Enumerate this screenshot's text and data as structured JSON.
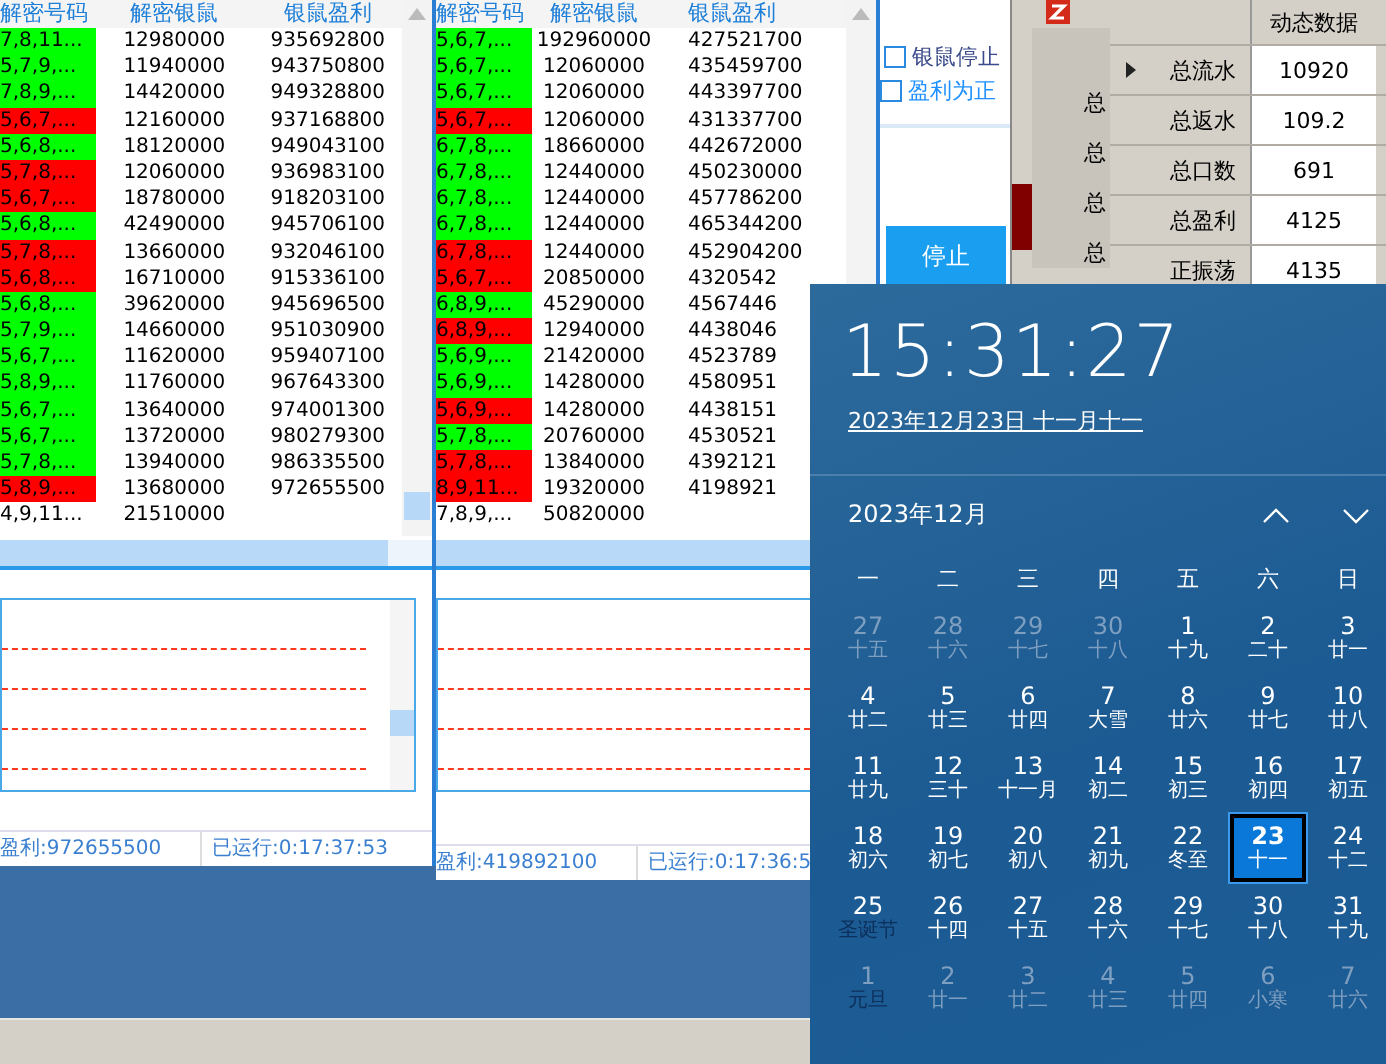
{
  "windows": [
    {
      "table": {
        "columns": [
          "解密号码",
          "解密银鼠",
          "银鼠盈利"
        ],
        "rows": [
          {
            "cells": [
              "7,8,11...",
              "12980000",
              "935692800"
            ],
            "color": "#00ff00"
          },
          {
            "cells": [
              "5,7,9,...",
              "11940000",
              "943750800"
            ],
            "color": "#00ff00"
          },
          {
            "cells": [
              "7,8,9,...",
              "14420000",
              "949328800"
            ],
            "color": "#00ff00"
          },
          {
            "cells": [
              "5,6,7,...",
              "12160000",
              "937168800"
            ],
            "color": "#ff0000"
          },
          {
            "cells": [
              "5,6,8,...",
              "18120000",
              "949043100"
            ],
            "color": "#00ff00"
          },
          {
            "cells": [
              "5,7,8,...",
              "12060000",
              "936983100"
            ],
            "color": "#ff0000"
          },
          {
            "cells": [
              "5,6,7,...",
              "18780000",
              "918203100"
            ],
            "color": "#ff0000"
          },
          {
            "cells": [
              "5,6,8,...",
              "42490000",
              "945706100"
            ],
            "color": "#00ff00"
          },
          {
            "cells": [
              "5,7,8,...",
              "13660000",
              "932046100"
            ],
            "color": "#ff0000"
          },
          {
            "cells": [
              "5,6,8,...",
              "16710000",
              "915336100"
            ],
            "color": "#ff0000"
          },
          {
            "cells": [
              "5,6,8,...",
              "39620000",
              "945696500"
            ],
            "color": "#00ff00"
          },
          {
            "cells": [
              "5,7,9,...",
              "14660000",
              "951030900"
            ],
            "color": "#00ff00"
          },
          {
            "cells": [
              "5,6,7,...",
              "11620000",
              "959407100"
            ],
            "color": "#00ff00"
          },
          {
            "cells": [
              "5,8,9,...",
              "11760000",
              "967643300"
            ],
            "color": "#00ff00"
          },
          {
            "cells": [
              "5,6,7,...",
              "13640000",
              "974001300"
            ],
            "color": "#00ff00"
          },
          {
            "cells": [
              "5,6,7,...",
              "13720000",
              "980279300"
            ],
            "color": "#00ff00"
          },
          {
            "cells": [
              "5,7,8,...",
              "13940000",
              "986335500"
            ],
            "color": "#00ff00"
          },
          {
            "cells": [
              "5,8,9,...",
              "13680000",
              "972655500"
            ],
            "color": "#ff0000"
          },
          {
            "cells": [
              "4,9,11...",
              "21510000",
              ""
            ],
            "color": "#ffffff"
          }
        ]
      },
      "status": [
        "盈利:972655500",
        "已运行:0:17:37:53"
      ]
    },
    {
      "table": {
        "columns": [
          "解密号码",
          "解密银鼠",
          "银鼠盈利"
        ],
        "rows": [
          {
            "cells": [
              "5,6,7,...",
              "192960000",
              "427521700"
            ],
            "color": "#00ff00"
          },
          {
            "cells": [
              "5,6,7,...",
              "12060000",
              "435459700"
            ],
            "color": "#00ff00"
          },
          {
            "cells": [
              "5,6,7,...",
              "12060000",
              "443397700"
            ],
            "color": "#00ff00"
          },
          {
            "cells": [
              "5,6,7,...",
              "12060000",
              "431337700"
            ],
            "color": "#ff0000"
          },
          {
            "cells": [
              "6,7,8,...",
              "18660000",
              "442672000"
            ],
            "color": "#00ff00"
          },
          {
            "cells": [
              "6,7,8,...",
              "12440000",
              "450230000"
            ],
            "color": "#00ff00"
          },
          {
            "cells": [
              "6,7,8,...",
              "12440000",
              "457786200"
            ],
            "color": "#00ff00"
          },
          {
            "cells": [
              "6,7,8,...",
              "12440000",
              "465344200"
            ],
            "color": "#00ff00"
          },
          {
            "cells": [
              "6,7,8,...",
              "12440000",
              "452904200"
            ],
            "color": "#ff0000"
          },
          {
            "cells": [
              "5,6,7,...",
              "20850000",
              "4320542"
            ],
            "color": "#ff0000"
          },
          {
            "cells": [
              "6,8,9,...",
              "45290000",
              "4567446"
            ],
            "color": "#00ff00"
          },
          {
            "cells": [
              "6,8,9,...",
              "12940000",
              "4438046"
            ],
            "color": "#ff0000"
          },
          {
            "cells": [
              "5,6,9,...",
              "21420000",
              "4523789"
            ],
            "color": "#00ff00"
          },
          {
            "cells": [
              "5,6,9,...",
              "14280000",
              "4580951"
            ],
            "color": "#00ff00"
          },
          {
            "cells": [
              "5,6,9,...",
              "14280000",
              "4438151"
            ],
            "color": "#ff0000"
          },
          {
            "cells": [
              "5,7,8,...",
              "20760000",
              "4530521"
            ],
            "color": "#00ff00"
          },
          {
            "cells": [
              "5,7,8,...",
              "13840000",
              "4392121"
            ],
            "color": "#ff0000"
          },
          {
            "cells": [
              "8,9,11...",
              "19320000",
              "4198921"
            ],
            "color": "#ff0000"
          },
          {
            "cells": [
              "7,8,9,...",
              "50820000",
              ""
            ],
            "color": "#ffffff"
          }
        ]
      },
      "status": [
        "盈利:419892100",
        "已运行:0:17:36:5"
      ]
    }
  ],
  "controls": {
    "checkboxes": [
      {
        "label": "银鼠停止",
        "checked": false
      },
      {
        "label": "盈利为正",
        "checked": false
      }
    ],
    "button": "停止"
  },
  "side_window": {
    "labels": [
      "总",
      "总",
      "总",
      "总"
    ]
  },
  "stats": {
    "column": "动态数据",
    "rows": [
      {
        "label": "总流水",
        "value": "10920",
        "selected": true
      },
      {
        "label": "总返水",
        "value": "109.2",
        "selected": false
      },
      {
        "label": "总口数",
        "value": "691",
        "selected": false
      },
      {
        "label": "总盈利",
        "value": "4125",
        "selected": false
      },
      {
        "label": "正振荡",
        "value": "4135",
        "selected": false
      }
    ]
  },
  "clock": {
    "time": "15:31:27",
    "date": "2023年12月23日 十一月十一",
    "month": "2023年12月",
    "weekdays": [
      "一",
      "二",
      "三",
      "四",
      "五",
      "六",
      "日"
    ],
    "days": [
      {
        "day": "27",
        "lunar": "十五",
        "in_month": false,
        "selected": false,
        "holiday": false
      },
      {
        "day": "28",
        "lunar": "十六",
        "in_month": false,
        "selected": false,
        "holiday": false
      },
      {
        "day": "29",
        "lunar": "十七",
        "in_month": false,
        "selected": false,
        "holiday": false
      },
      {
        "day": "30",
        "lunar": "十八",
        "in_month": false,
        "selected": false,
        "holiday": false
      },
      {
        "day": "1",
        "lunar": "十九",
        "in_month": true,
        "selected": false,
        "holiday": false
      },
      {
        "day": "2",
        "lunar": "二十",
        "in_month": true,
        "selected": false,
        "holiday": false
      },
      {
        "day": "3",
        "lunar": "廿一",
        "in_month": true,
        "selected": false,
        "holiday": false
      },
      {
        "day": "4",
        "lunar": "廿二",
        "in_month": true,
        "selected": false,
        "holiday": false
      },
      {
        "day": "5",
        "lunar": "廿三",
        "in_month": true,
        "selected": false,
        "holiday": false
      },
      {
        "day": "6",
        "lunar": "廿四",
        "in_month": true,
        "selected": false,
        "holiday": false
      },
      {
        "day": "7",
        "lunar": "大雪",
        "in_month": true,
        "selected": false,
        "holiday": false
      },
      {
        "day": "8",
        "lunar": "廿六",
        "in_month": true,
        "selected": false,
        "holiday": false
      },
      {
        "day": "9",
        "lunar": "廿七",
        "in_month": true,
        "selected": false,
        "holiday": false
      },
      {
        "day": "10",
        "lunar": "廿八",
        "in_month": true,
        "selected": false,
        "holiday": false
      },
      {
        "day": "11",
        "lunar": "廿九",
        "in_month": true,
        "selected": false,
        "holiday": false
      },
      {
        "day": "12",
        "lunar": "三十",
        "in_month": true,
        "selected": false,
        "holiday": false
      },
      {
        "day": "13",
        "lunar": "十一月",
        "in_month": true,
        "selected": false,
        "holiday": false
      },
      {
        "day": "14",
        "lunar": "初二",
        "in_month": true,
        "selected": false,
        "holiday": false
      },
      {
        "day": "15",
        "lunar": "初三",
        "in_month": true,
        "selected": false,
        "holiday": false
      },
      {
        "day": "16",
        "lunar": "初四",
        "in_month": true,
        "selected": false,
        "holiday": false
      },
      {
        "day": "17",
        "lunar": "初五",
        "in_month": true,
        "selected": false,
        "holiday": false
      },
      {
        "day": "18",
        "lunar": "初六",
        "in_month": true,
        "selected": false,
        "holiday": false
      },
      {
        "day": "19",
        "lunar": "初七",
        "in_month": true,
        "selected": false,
        "holiday": false
      },
      {
        "day": "20",
        "lunar": "初八",
        "in_month": true,
        "selected": false,
        "holiday": false
      },
      {
        "day": "21",
        "lunar": "初九",
        "in_month": true,
        "selected": false,
        "holiday": false
      },
      {
        "day": "22",
        "lunar": "冬至",
        "in_month": true,
        "selected": false,
        "holiday": false
      },
      {
        "day": "23",
        "lunar": "十一",
        "in_month": true,
        "selected": true,
        "holiday": false
      },
      {
        "day": "24",
        "lunar": "十二",
        "in_month": true,
        "selected": false,
        "holiday": false
      },
      {
        "day": "25",
        "lunar": "圣诞节",
        "in_month": true,
        "selected": false,
        "holiday": true
      },
      {
        "day": "26",
        "lunar": "十四",
        "in_month": true,
        "selected": false,
        "holiday": false
      },
      {
        "day": "27",
        "lunar": "十五",
        "in_month": true,
        "selected": false,
        "holiday": false
      },
      {
        "day": "28",
        "lunar": "十六",
        "in_month": true,
        "selected": false,
        "holiday": false
      },
      {
        "day": "29",
        "lunar": "十七",
        "in_month": true,
        "selected": false,
        "holiday": false
      },
      {
        "day": "30",
        "lunar": "十八",
        "in_month": true,
        "selected": false,
        "holiday": false
      },
      {
        "day": "31",
        "lunar": "十九",
        "in_month": true,
        "selected": false,
        "holiday": false
      },
      {
        "day": "1",
        "lunar": "元旦",
        "in_month": false,
        "selected": false,
        "holiday": true
      },
      {
        "day": "2",
        "lunar": "廿一",
        "in_month": false,
        "selected": false,
        "holiday": false
      },
      {
        "day": "3",
        "lunar": "廿二",
        "in_month": false,
        "selected": false,
        "holiday": false
      },
      {
        "day": "4",
        "lunar": "廿三",
        "in_month": false,
        "selected": false,
        "holiday": false
      },
      {
        "day": "5",
        "lunar": "廿四",
        "in_month": false,
        "selected": false,
        "holiday": false
      },
      {
        "day": "6",
        "lunar": "小寒",
        "in_month": false,
        "selected": false,
        "holiday": false
      },
      {
        "day": "7",
        "lunar": "廿六",
        "in_month": false,
        "selected": false,
        "holiday": false
      }
    ]
  }
}
